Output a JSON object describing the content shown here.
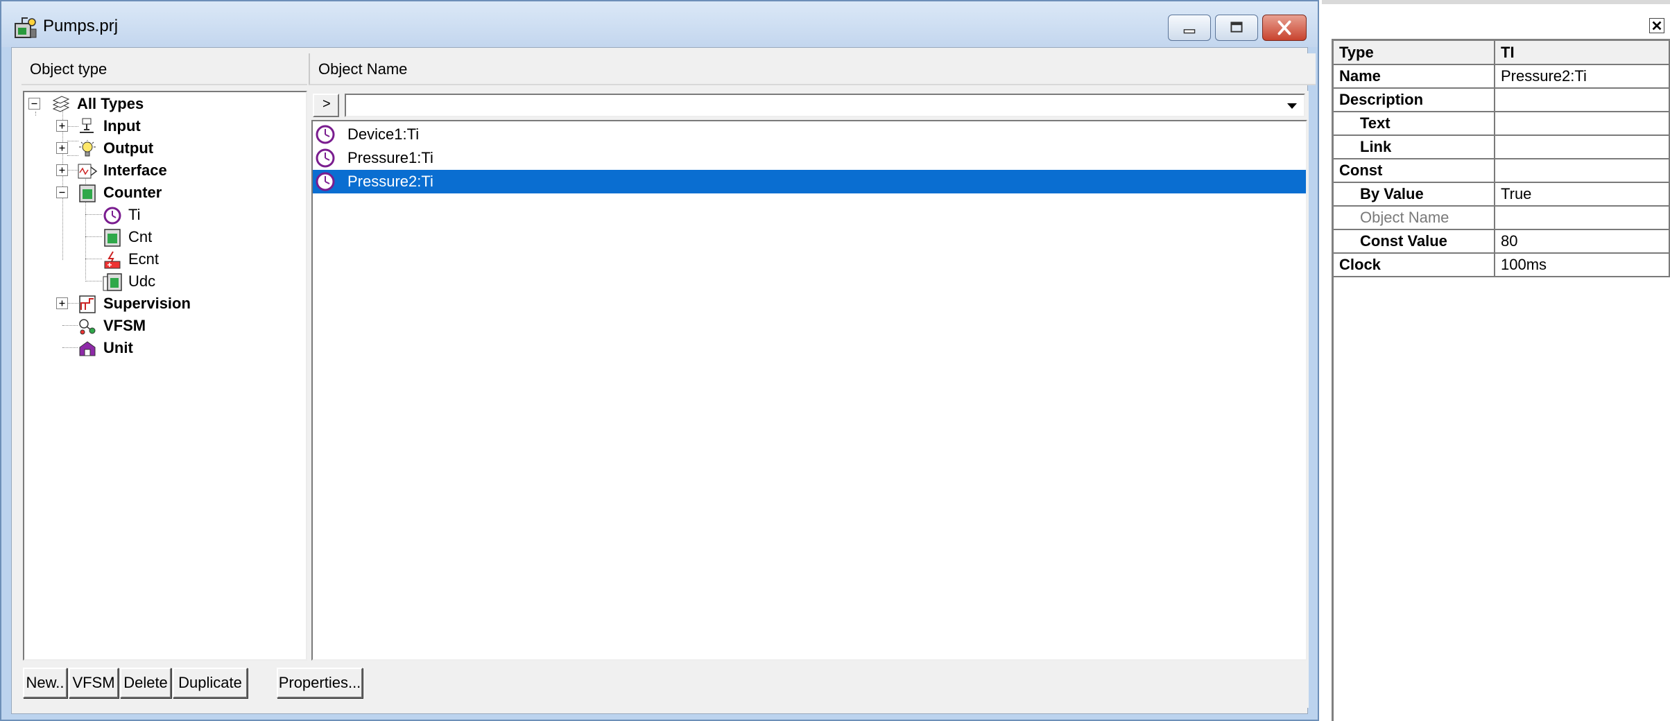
{
  "window": {
    "title": "Pumps.prj"
  },
  "headers": {
    "object_type": "Object type",
    "object_name": "Object Name"
  },
  "tree": {
    "items": [
      {
        "label": "All Types"
      },
      {
        "label": "Input"
      },
      {
        "label": "Output"
      },
      {
        "label": "Interface"
      },
      {
        "label": "Counter"
      },
      {
        "label": "Ti"
      },
      {
        "label": "Cnt"
      },
      {
        "label": "Ecnt"
      },
      {
        "label": "Udc"
      },
      {
        "label": "Supervision"
      },
      {
        "label": "VFSM"
      },
      {
        "label": "Unit"
      }
    ]
  },
  "filter": {
    "button_label": ">",
    "value": ""
  },
  "objects": [
    {
      "name": "Device1:Ti",
      "selected": false
    },
    {
      "name": "Pressure1:Ti",
      "selected": false
    },
    {
      "name": "Pressure2:Ti",
      "selected": true
    }
  ],
  "buttons": {
    "new": "New..",
    "vfsm": "VFSM",
    "delete": "Delete",
    "duplicate": "Duplicate",
    "properties": "Properties..."
  },
  "properties": {
    "rows": [
      {
        "key": "Type",
        "value": "TI"
      },
      {
        "key": "Name",
        "value": "Pressure2:Ti"
      },
      {
        "key": "Description",
        "value": ""
      },
      {
        "key": "Text",
        "value": ""
      },
      {
        "key": "Link",
        "value": ""
      },
      {
        "key": "Const",
        "value": ""
      },
      {
        "key": "By Value",
        "value": "True"
      },
      {
        "key": "Object Name",
        "value": ""
      },
      {
        "key": "Const Value",
        "value": "80"
      },
      {
        "key": "Clock",
        "value": "100ms"
      }
    ]
  },
  "colors": {
    "selection": "#0a6ed1",
    "title_bar": "#c3d6ee",
    "close_button": "#c8432e",
    "panel": "#f0f0f0"
  }
}
